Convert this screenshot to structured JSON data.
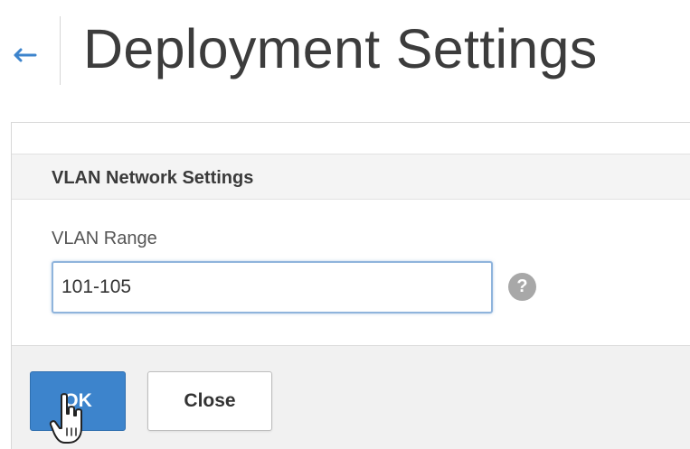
{
  "header": {
    "back_icon": "back-arrow-icon",
    "title": "Deployment Settings"
  },
  "section": {
    "title": "VLAN Network Settings"
  },
  "vlan_range": {
    "label": "VLAN Range",
    "value": "101-105",
    "help_icon": "help-icon",
    "help_glyph": "?"
  },
  "footer": {
    "ok_label": "OK",
    "close_label": "Close"
  },
  "cursor": {
    "icon": "hand-pointer-icon"
  },
  "colors": {
    "primary_button": "#3d84cc",
    "back_arrow": "#3d84cc",
    "input_border": "#8fb4dc",
    "help_icon": "#a8a8a8",
    "footer_background": "#f1f1f1",
    "section_header_background": "#f4f4f4"
  }
}
